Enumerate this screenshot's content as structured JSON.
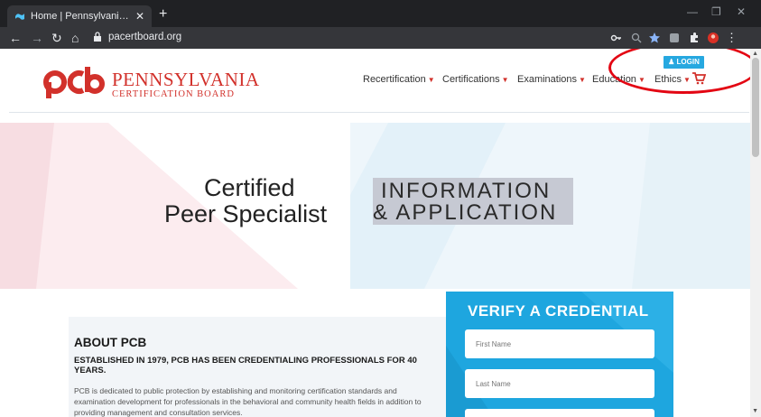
{
  "browser": {
    "tab_title": "Home | Pennsylvania Certification",
    "url": "pacertboard.org"
  },
  "site": {
    "logo_mark": "pcb",
    "logo_name": "PENNSYLVANIA",
    "logo_sub": "CERTIFICATION BOARD",
    "login_label": "LOGIN",
    "nav": [
      "Recertification",
      "Certifications",
      "Examinations",
      "Education",
      "Ethics"
    ]
  },
  "hero": {
    "title_line1": "Certified",
    "title_line2": "Peer Specialist",
    "badge_line1": "INFORMATION",
    "badge_line2": "& APPLICATION"
  },
  "about": {
    "title": "ABOUT PCB",
    "subtitle": "ESTABLISHED IN 1979, PCB HAS BEEN CREDENTIALING PROFESSIONALS FOR 40 YEARS.",
    "body": "PCB is dedicated to public protection by establishing and monitoring certification standards and examination development for professionals in the behavioral and community health fields in addition to providing management and consultation services."
  },
  "verify": {
    "title": "VERIFY A CREDENTIAL",
    "first_name_placeholder": "First Name",
    "last_name_placeholder": "Last Name"
  },
  "colors": {
    "brand_red": "#d2312b",
    "accent_blue": "#1ea6df",
    "annotation_red": "#e30613"
  }
}
